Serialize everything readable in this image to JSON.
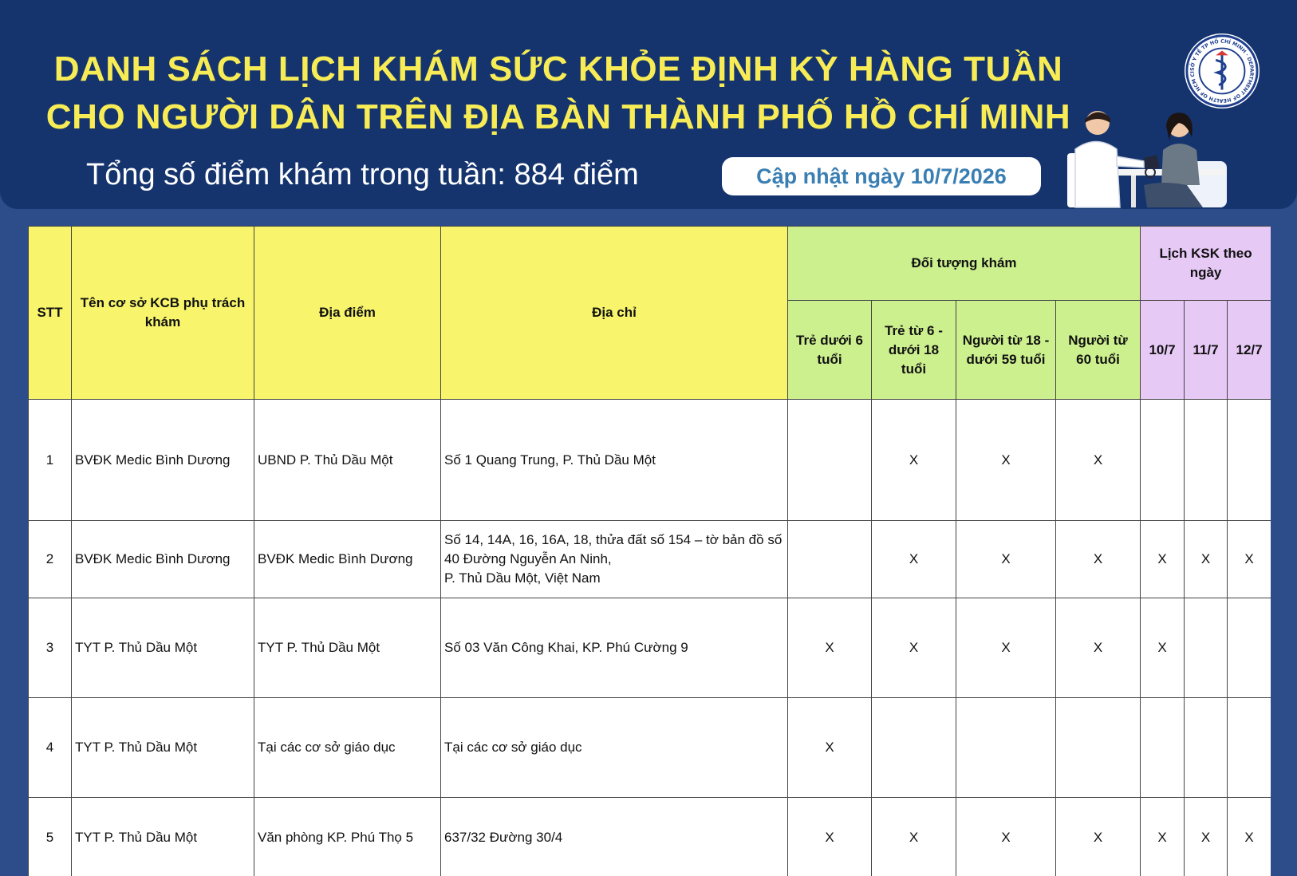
{
  "header": {
    "title_line1": "DANH SÁCH LỊCH KHÁM SỨC KHỎE ĐỊNH KỲ HÀNG TUẦN",
    "title_line2": "CHO NGƯỜI DÂN TRÊN ĐỊA BÀN THÀNH PHỐ HỒ CHÍ MINH",
    "total_points": "Tổng số điểm khám trong tuần: 884 điểm",
    "updated": "Cập nhật ngày 10/7/2026",
    "logo_text": "SỞ Y TẾ TP HỒ CHÍ MINH · DEPARTMENT OF HEALTH OF HCM CITY"
  },
  "colors": {
    "header_bg": "#15346e",
    "page_bg": "#2c4d8a",
    "title": "#f7ec55",
    "update_text": "#3a7fb3",
    "col_yellow": "#f8f56c",
    "col_green": "#cdf08f",
    "col_purple": "#e7c9f6"
  },
  "table": {
    "headers": {
      "stt": "STT",
      "facility": "Tên cơ sở KCB phụ trách khám",
      "location": "Địa điểm",
      "address": "Địa chỉ",
      "target_group": "Đối tượng khám",
      "schedule_group": "Lịch KSK theo ngày",
      "targets": [
        "Trẻ dưới 6 tuổi",
        "Trẻ từ 6 - dưới 18 tuổi",
        "Người từ 18 - dưới 59 tuổi",
        "Người từ 60 tuổi"
      ],
      "dates": [
        "10/7",
        "11/7",
        "12/7"
      ]
    },
    "rows": [
      {
        "stt": "1",
        "facility": "BVĐK Medic Bình Dương",
        "location": "UBND P. Thủ Dầu Một",
        "address": "Số 1 Quang Trung, P. Thủ Dầu Một",
        "targets": [
          "",
          "X",
          "X",
          "X"
        ],
        "dates": [
          "",
          "",
          ""
        ]
      },
      {
        "stt": "2",
        "facility": "BVĐK Medic Bình Dương",
        "location": "BVĐK Medic Bình Dương",
        "address": "Số 14, 14A, 16, 16A, 18, thửa đất số 154 – tờ bản đồ số 40 Đường Nguyễn An Ninh,\n P. Thủ Dầu Một, Việt Nam",
        "targets": [
          "",
          "X",
          "X",
          "X"
        ],
        "dates": [
          "X",
          "X",
          "X"
        ]
      },
      {
        "stt": "3",
        "facility": "TYT P. Thủ Dầu Một",
        "location": "TYT P. Thủ Dầu Một",
        "address": "Số 03 Văn Công Khai, KP. Phú Cường 9",
        "targets": [
          "X",
          "X",
          "X",
          "X"
        ],
        "dates": [
          "X",
          "",
          ""
        ]
      },
      {
        "stt": "4",
        "facility": "TYT P. Thủ Dầu Một",
        "location": "Tại các cơ sở giáo dục",
        "address": "Tại các cơ sở giáo dục",
        "targets": [
          "X",
          "",
          "",
          ""
        ],
        "dates": [
          "",
          "",
          ""
        ]
      },
      {
        "stt": "5",
        "facility": "TYT P. Thủ Dầu Một",
        "location": "Văn phòng KP. Phú Thọ 5",
        "address": "637/32 Đường 30/4",
        "targets": [
          "X",
          "X",
          "X",
          "X"
        ],
        "dates": [
          "X",
          "X",
          "X"
        ]
      }
    ]
  }
}
